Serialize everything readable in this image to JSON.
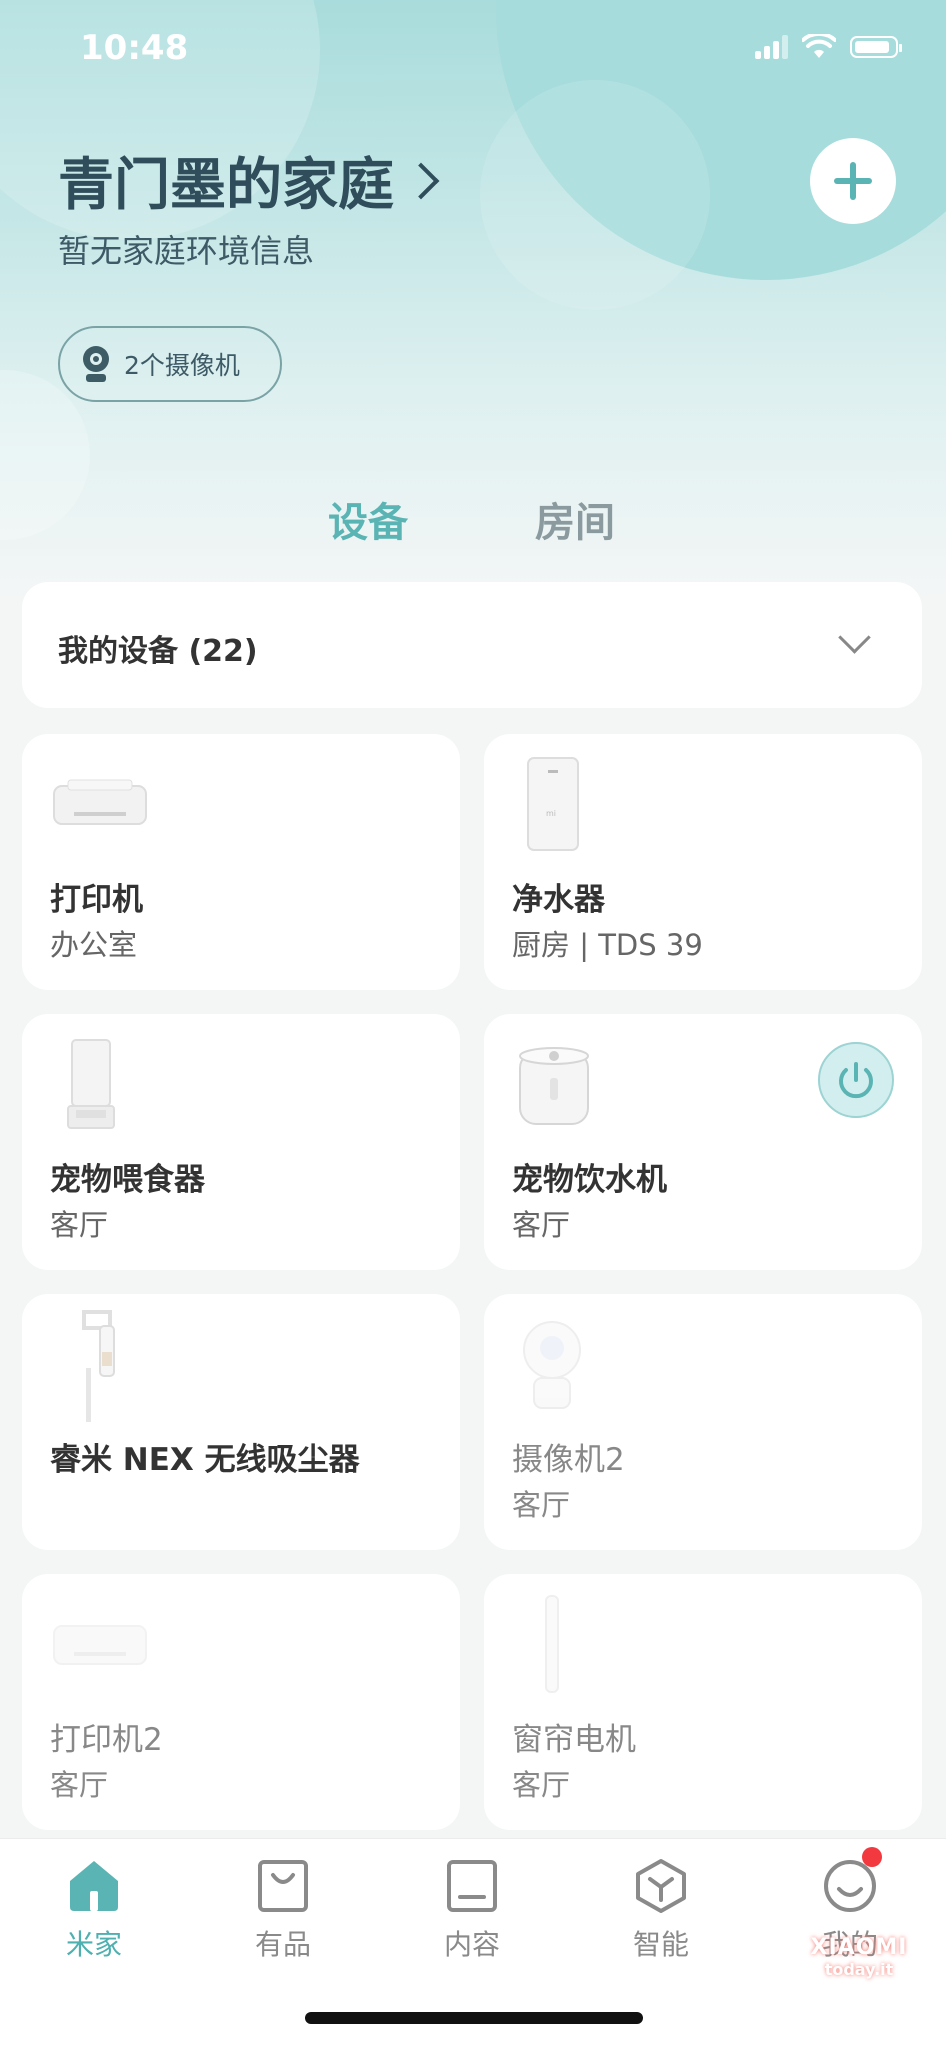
{
  "status_bar": {
    "time": "10:48"
  },
  "header": {
    "home_name": "青门墨的家庭",
    "subtitle": "暂无家庭环境信息",
    "camera_pill": "2个摄像机"
  },
  "tabs": [
    {
      "label": "设备",
      "active": true
    },
    {
      "label": "房间",
      "active": false
    }
  ],
  "device_filter": {
    "label": "我的设备 (22)"
  },
  "devices": [
    {
      "name": "打印机",
      "room": "办公室",
      "icon": "printer-icon",
      "online": true
    },
    {
      "name": "净水器",
      "room": "厨房 | TDS 39",
      "icon": "water-purifier-icon",
      "online": true
    },
    {
      "name": "宠物喂食器",
      "room": "客厅",
      "icon": "pet-feeder-icon",
      "online": true
    },
    {
      "name": "宠物饮水机",
      "room": "客厅",
      "icon": "pet-fountain-icon",
      "online": true,
      "power_button": true
    },
    {
      "name": "睿米 NEX 无线吸尘器",
      "room": "",
      "icon": "vacuum-icon",
      "online": true
    },
    {
      "name": "摄像机2",
      "room": "客厅",
      "icon": "camera-icon",
      "online": false
    },
    {
      "name": "打印机2",
      "room": "客厅",
      "icon": "printer-icon",
      "online": false
    },
    {
      "name": "窗帘电机",
      "room": "客厅",
      "icon": "curtain-motor-icon",
      "online": false
    }
  ],
  "tab_bar": [
    {
      "label": "米家",
      "icon": "home-icon",
      "active": true
    },
    {
      "label": "有品",
      "icon": "shopping-bag-icon",
      "active": false
    },
    {
      "label": "内容",
      "icon": "content-icon",
      "active": false
    },
    {
      "label": "智能",
      "icon": "cube-icon",
      "active": false
    },
    {
      "label": "我的",
      "icon": "profile-smile-icon",
      "active": false,
      "badge": true
    }
  ],
  "watermark": {
    "brand": "XIAOMI",
    "site": "today.it"
  },
  "colors": {
    "accent": "#5bb4b4",
    "header_bg": "#a9dcdc",
    "badge": "#f2393f"
  }
}
